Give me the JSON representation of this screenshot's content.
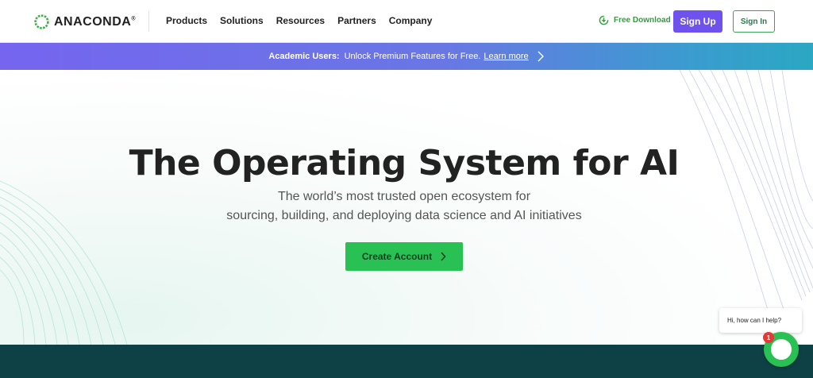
{
  "brand": {
    "name": "ANACONDA",
    "mark": "®",
    "color": "#43b049"
  },
  "nav": {
    "items": [
      "Products",
      "Solutions",
      "Resources",
      "Partners",
      "Company"
    ]
  },
  "header_actions": {
    "free_download": "Free Download",
    "sign_up": "Sign Up",
    "sign_in": "Sign In"
  },
  "banner": {
    "prefix": "Academic Users:",
    "text": "Unlock Premium Features for Free.",
    "link": "Learn more"
  },
  "hero": {
    "title": "The Operating System for AI",
    "subtitle_line1": "The world’s most trusted open ecosystem for",
    "subtitle_line2": "sourcing, building, and deploying data science and AI initiatives",
    "cta": "Create Account"
  },
  "chat": {
    "greeting": "Hi, how can I help?",
    "badge": "1"
  },
  "colors": {
    "accent_purple": "#6f52ed",
    "accent_green": "#2ac154",
    "footer_band": "#0e4145"
  }
}
